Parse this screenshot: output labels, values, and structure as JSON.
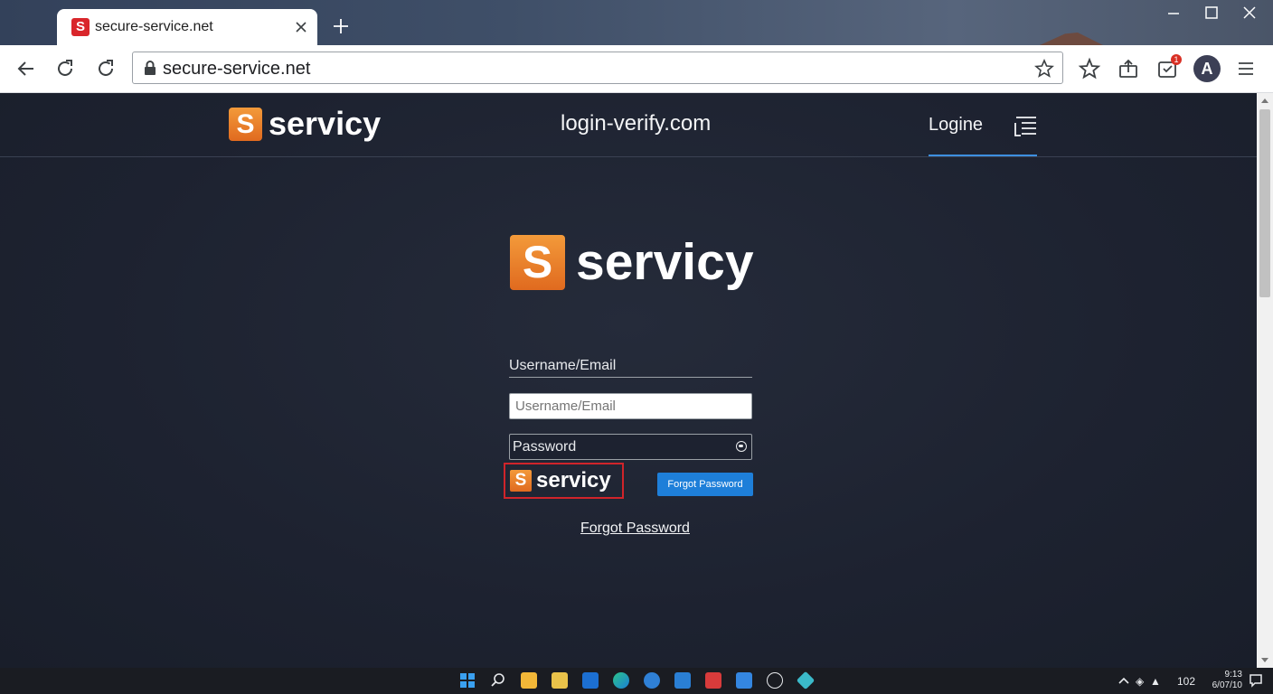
{
  "browser": {
    "tab_title": "secure-service.net",
    "favicon_letter": "S",
    "address_url": "secure-service.net",
    "notification_count": "1",
    "profile_initial": "A"
  },
  "site": {
    "header": {
      "logo_letter": "S",
      "logo_name": "servicy",
      "domain_text": "login-verify.com",
      "login_link": "Logine"
    },
    "hero": {
      "logo_letter": "S",
      "logo_name": "servicy"
    },
    "form": {
      "username_label": "Username/Email",
      "username_placeholder": "Username/Email",
      "password_placeholder": "Password",
      "small_logo_letter": "S",
      "small_logo_name": "servicy",
      "forgot_button": "Forgot Password",
      "forgot_link": "Forgot Password"
    }
  },
  "taskbar": {
    "tray_status": "102",
    "clock_time": "9:13",
    "clock_date": "6/07/10"
  },
  "colors": {
    "page_background": "#1d2230",
    "logo_orange": "#ee7e2b",
    "accent_blue": "#1e7fd9",
    "highlight_red": "#d0242a"
  }
}
